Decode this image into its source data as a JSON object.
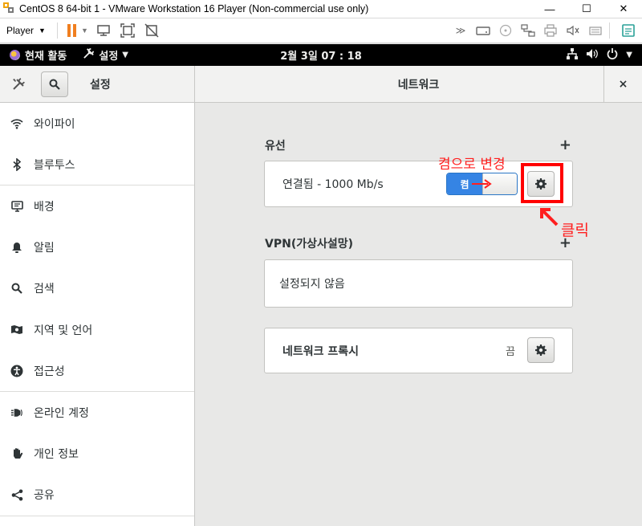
{
  "window": {
    "title": "CentOS 8 64-bit 1 - VMware Workstation 16 Player (Non-commercial use only)",
    "minimize": "—",
    "maximize": "☐",
    "close": "✕"
  },
  "vm_toolbar": {
    "player_menu": "Player",
    "right_overflow": "≫"
  },
  "gnome_bar": {
    "activities": "현재 활동",
    "app_menu": "설정",
    "clock": "2월 3일  07 : 18"
  },
  "settings": {
    "title": "설정",
    "panel_title": "네트워크",
    "close": "×",
    "sidebar": [
      {
        "label": "와이파이",
        "icon": "wifi-icon"
      },
      {
        "label": "블루투스",
        "icon": "bluetooth-icon"
      },
      {
        "label": "배경",
        "icon": "background-icon"
      },
      {
        "label": "알림",
        "icon": "notification-bell-icon"
      },
      {
        "label": "검색",
        "icon": "search-icon"
      },
      {
        "label": "지역 및 언어",
        "icon": "region-flag-icon"
      },
      {
        "label": "접근성",
        "icon": "accessibility-icon"
      },
      {
        "label": "온라인 계정",
        "icon": "online-accounts-icon"
      },
      {
        "label": "개인 정보",
        "icon": "privacy-hand-icon"
      },
      {
        "label": "공유",
        "icon": "share-icon"
      }
    ]
  },
  "network": {
    "wired": {
      "heading": "유선",
      "add": "+",
      "status": "연결됨 - 1000 Mb/s",
      "switch_on": "켬"
    },
    "vpn": {
      "heading": "VPN(가상사설망)",
      "add": "+",
      "empty": "설정되지 않음"
    },
    "proxy": {
      "label": "네트워크 프록시",
      "state": "끔"
    }
  },
  "annotations": {
    "change_to_on": "켬으로 변경",
    "click": "클릭",
    "color": "#ff0000"
  }
}
